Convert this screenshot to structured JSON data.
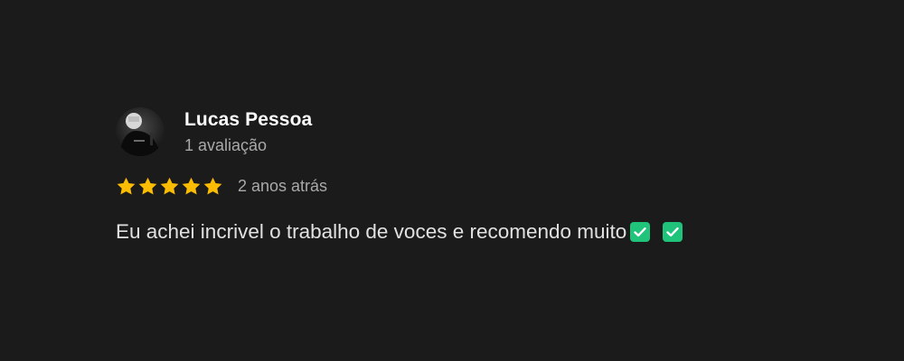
{
  "review": {
    "author_name": "Lucas Pessoa",
    "review_count": "1 avaliação",
    "rating": 5,
    "rating_max": 5,
    "time_ago": "2 anos atrás",
    "text": "Eu achei incrivel o trabalho de voces e recomendo muito",
    "emojis": [
      "check-mark-button-icon",
      "check-mark-button-icon"
    ]
  },
  "colors": {
    "background": "#1b1b1b",
    "star": "#fbbc04",
    "emoji_check": "#1fc37a",
    "name": "#ffffff",
    "secondary_text": "#a9a9a9",
    "body_text": "#e1e1e1"
  }
}
